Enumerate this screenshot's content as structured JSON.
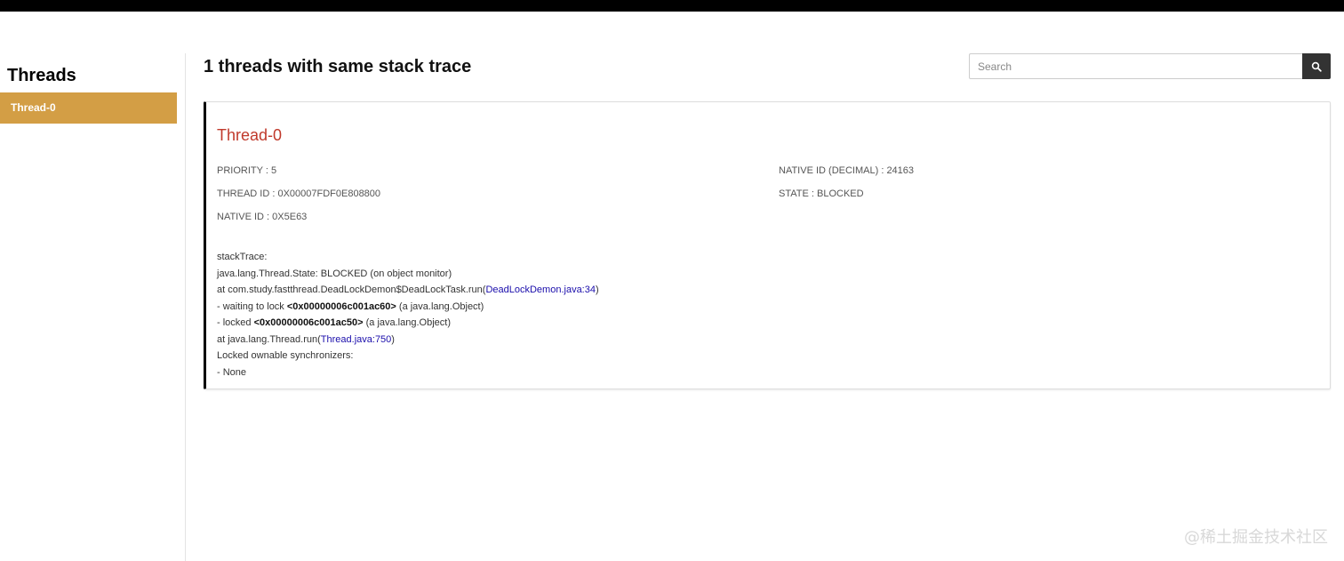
{
  "sidebar": {
    "title": "Threads",
    "items": [
      {
        "label": "Thread-0"
      }
    ]
  },
  "main": {
    "title": "1 threads with same stack trace",
    "search": {
      "placeholder": "Search",
      "value": ""
    }
  },
  "thread": {
    "name": "Thread-0",
    "left_props": [
      {
        "label": "PRIORITY",
        "value": "5"
      },
      {
        "label": "THREAD ID",
        "value": "0X00007FDF0E808800"
      },
      {
        "label": "NATIVE ID",
        "value": "0X5E63"
      }
    ],
    "right_props": [
      {
        "label": "NATIVE ID (DECIMAL)",
        "value": "24163"
      },
      {
        "label": "STATE",
        "value": "BLOCKED"
      }
    ],
    "stack": {
      "header": "stackTrace:",
      "state_line": "java.lang.Thread.State: BLOCKED (on object monitor)",
      "frame1_prefix": "at com.study.fastthread.DeadLockDemon$DeadLockTask.run(",
      "frame1_link": "DeadLockDemon.java:34",
      "frame1_suffix": ")",
      "wait_prefix": "- waiting to lock ",
      "wait_addr": "<0x00000006c001ac60>",
      "wait_suffix": " (a java.lang.Object)",
      "locked_prefix": "- locked ",
      "locked_addr": "<0x00000006c001ac50>",
      "locked_suffix": " (a java.lang.Object)",
      "frame2_prefix": "at java.lang.Thread.run(",
      "frame2_link": "Thread.java:750",
      "frame2_suffix": ")",
      "sync_header": "Locked ownable synchronizers:",
      "sync_value": "- None"
    }
  },
  "watermark": "@稀土掘金技术社区",
  "colors": {
    "accent": "#d39e45",
    "thread_name": "#c0392b",
    "link": "#1a0dab",
    "topbar": "#000000"
  }
}
